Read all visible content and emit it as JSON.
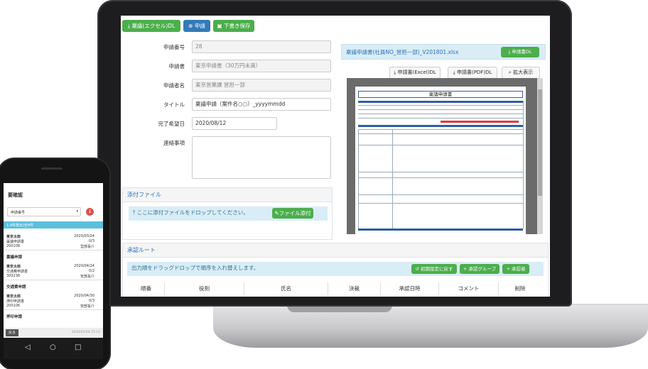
{
  "toolbar": {
    "template_dl": "稟議(エクセル)DL",
    "apply": "申請",
    "save_draft": "下書き保存"
  },
  "form": {
    "app_no_label": "申請番号",
    "app_no": "28",
    "form_label": "申請書",
    "form_value": "東京申請書（30万円未満）",
    "applicant_label": "申請者名",
    "applicant": "東京営業課 営担一部",
    "title_label": "タイトル",
    "title": "稟議申請（案件名○○）_yyyymmdd",
    "due_label": "完了希望日",
    "due": "2020/08/12",
    "notes_label": "連絡事項",
    "notes": ""
  },
  "attach": {
    "header": "添付ファイル",
    "drop": "ここに添付ファイルをドロップしてください。",
    "button": "ファイル添付"
  },
  "route": {
    "header": "承認ルート",
    "hint": "出力順をドラッグドロップで順序を入れ替えします。",
    "reset": "初期設定に戻す",
    "add_group": "承認グループ",
    "add_approver": "承認者",
    "columns": [
      "順番",
      "役割",
      "氏名",
      "決裁",
      "承認日時",
      "コメント",
      "削除"
    ]
  },
  "preview": {
    "filename": "稟議申請書(社員NO_営担一部)_V201801.xlsx",
    "dl_button": "申請書DL",
    "excel_dl": "申請書(Excel)DL",
    "pdf_dl": "申請書(PDF)DL",
    "zoom": "拡大表示",
    "doc_title": "稟議申請書"
  },
  "phone": {
    "title": "要確認",
    "select": "申請番号",
    "tab": "1-4件表示/全4件",
    "items": [
      {
        "a": "東京太郎",
        "b": "2020/03/24",
        "c": "稟議申請書",
        "d": "0/3",
        "e": "200108",
        "f": "営部長介",
        "sec": "稟議申請"
      },
      {
        "a": "東京太郎",
        "b": "2020/04/24",
        "c": "交通費申請書",
        "d": "0/2",
        "e": "300238",
        "f": "安部長介",
        "sec": "交通費申請"
      },
      {
        "a": "東京太郎",
        "b": "2020/04/30",
        "c": "押印申請書",
        "d": "0/3",
        "e": "200106",
        "f": "安部長介",
        "sec": "押印申請"
      }
    ],
    "back": "戻る",
    "footer": "2020/02/04 15:15"
  },
  "colors": {
    "green": "#4cae4c",
    "blue": "#337ab7",
    "info": "#d9edf7",
    "link": "#2a72b5",
    "doc_bar": "#2f5ea5"
  }
}
